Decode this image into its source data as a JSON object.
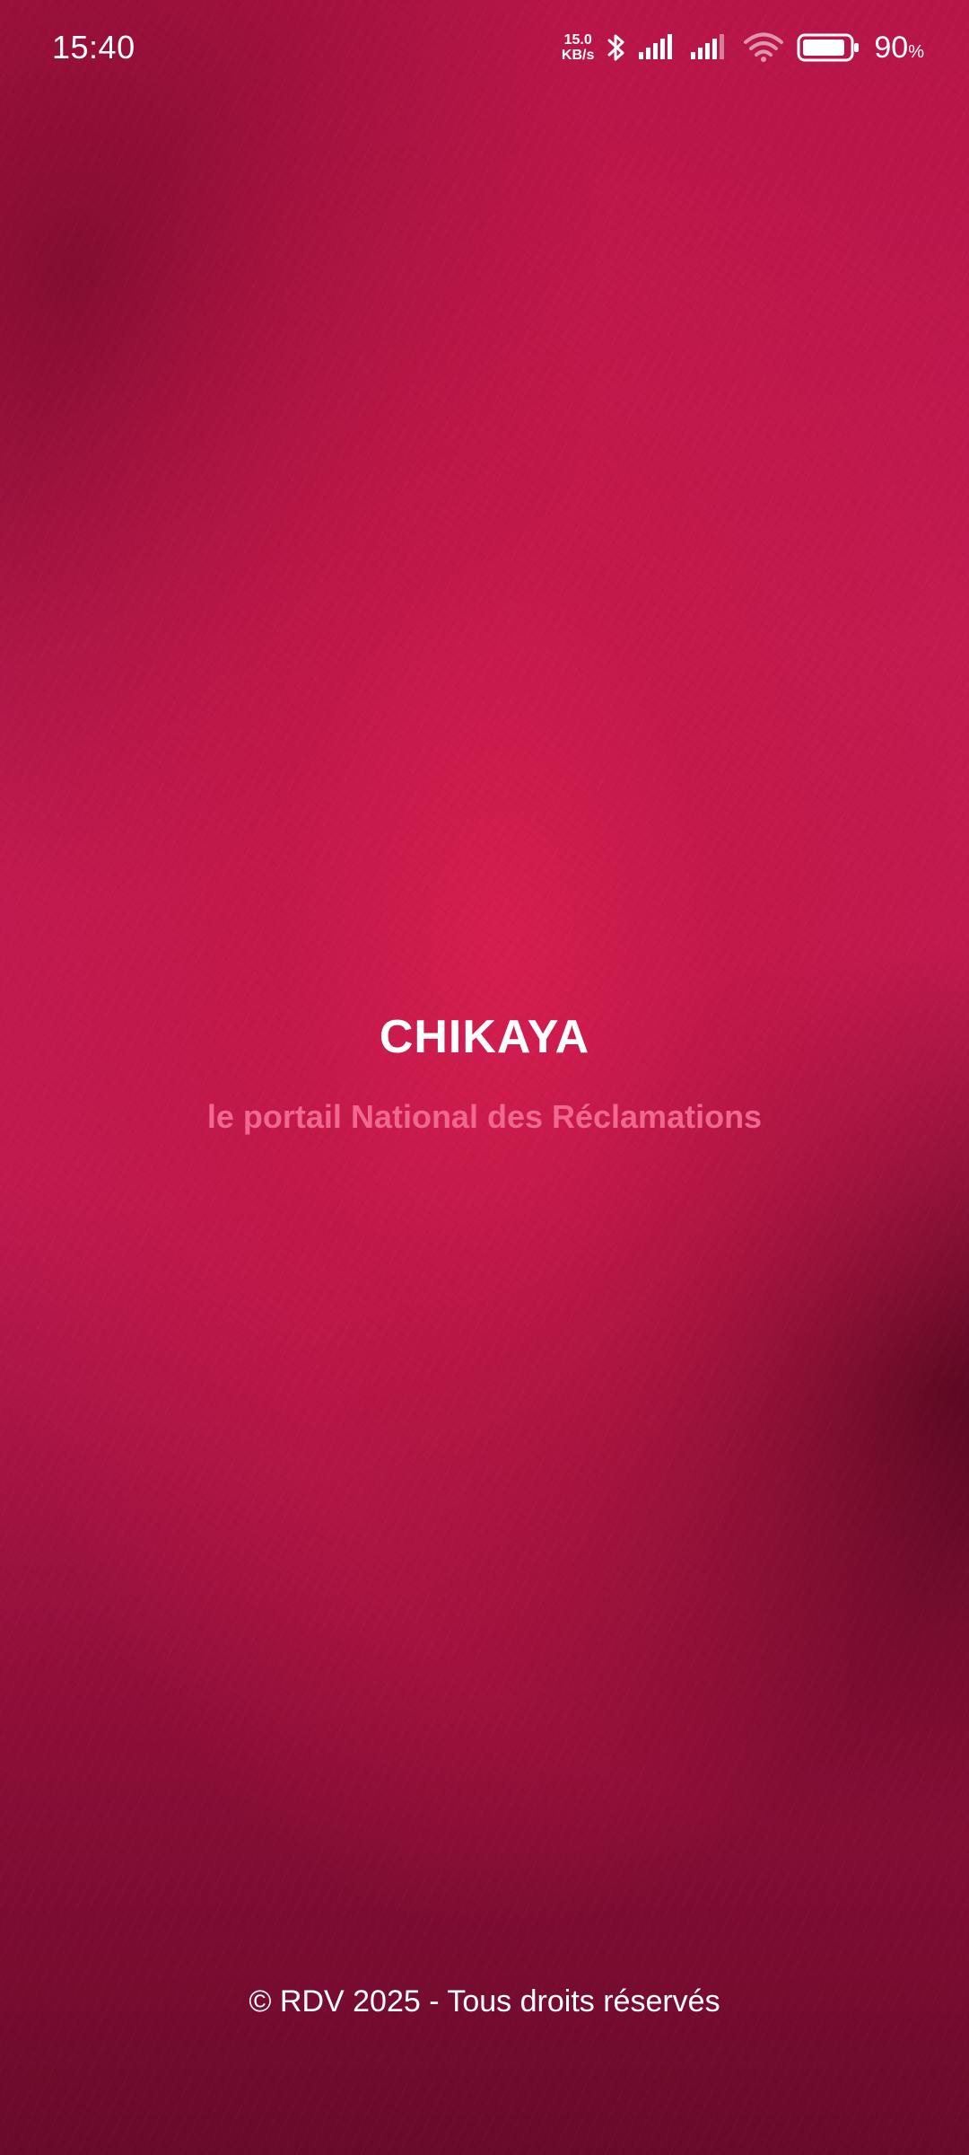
{
  "status_bar": {
    "time": "15:40",
    "net_speed_value": "15.0",
    "net_speed_unit": "KB/s",
    "battery_percent": "90",
    "battery_percent_sign": "%",
    "icons": [
      "bluetooth-icon",
      "signal-icon",
      "signal-icon",
      "wifi-icon",
      "battery-icon"
    ]
  },
  "splash": {
    "title": "CHIKAYA",
    "subtitle": "le portail National des Réclamations"
  },
  "footer": {
    "copyright": "© RDV 2025 - Tous droits réservés"
  },
  "colors": {
    "background_primary": "#c41b52",
    "background_dark": "#6a0a2a",
    "title": "#ffffff",
    "subtitle": "#f0678f"
  }
}
